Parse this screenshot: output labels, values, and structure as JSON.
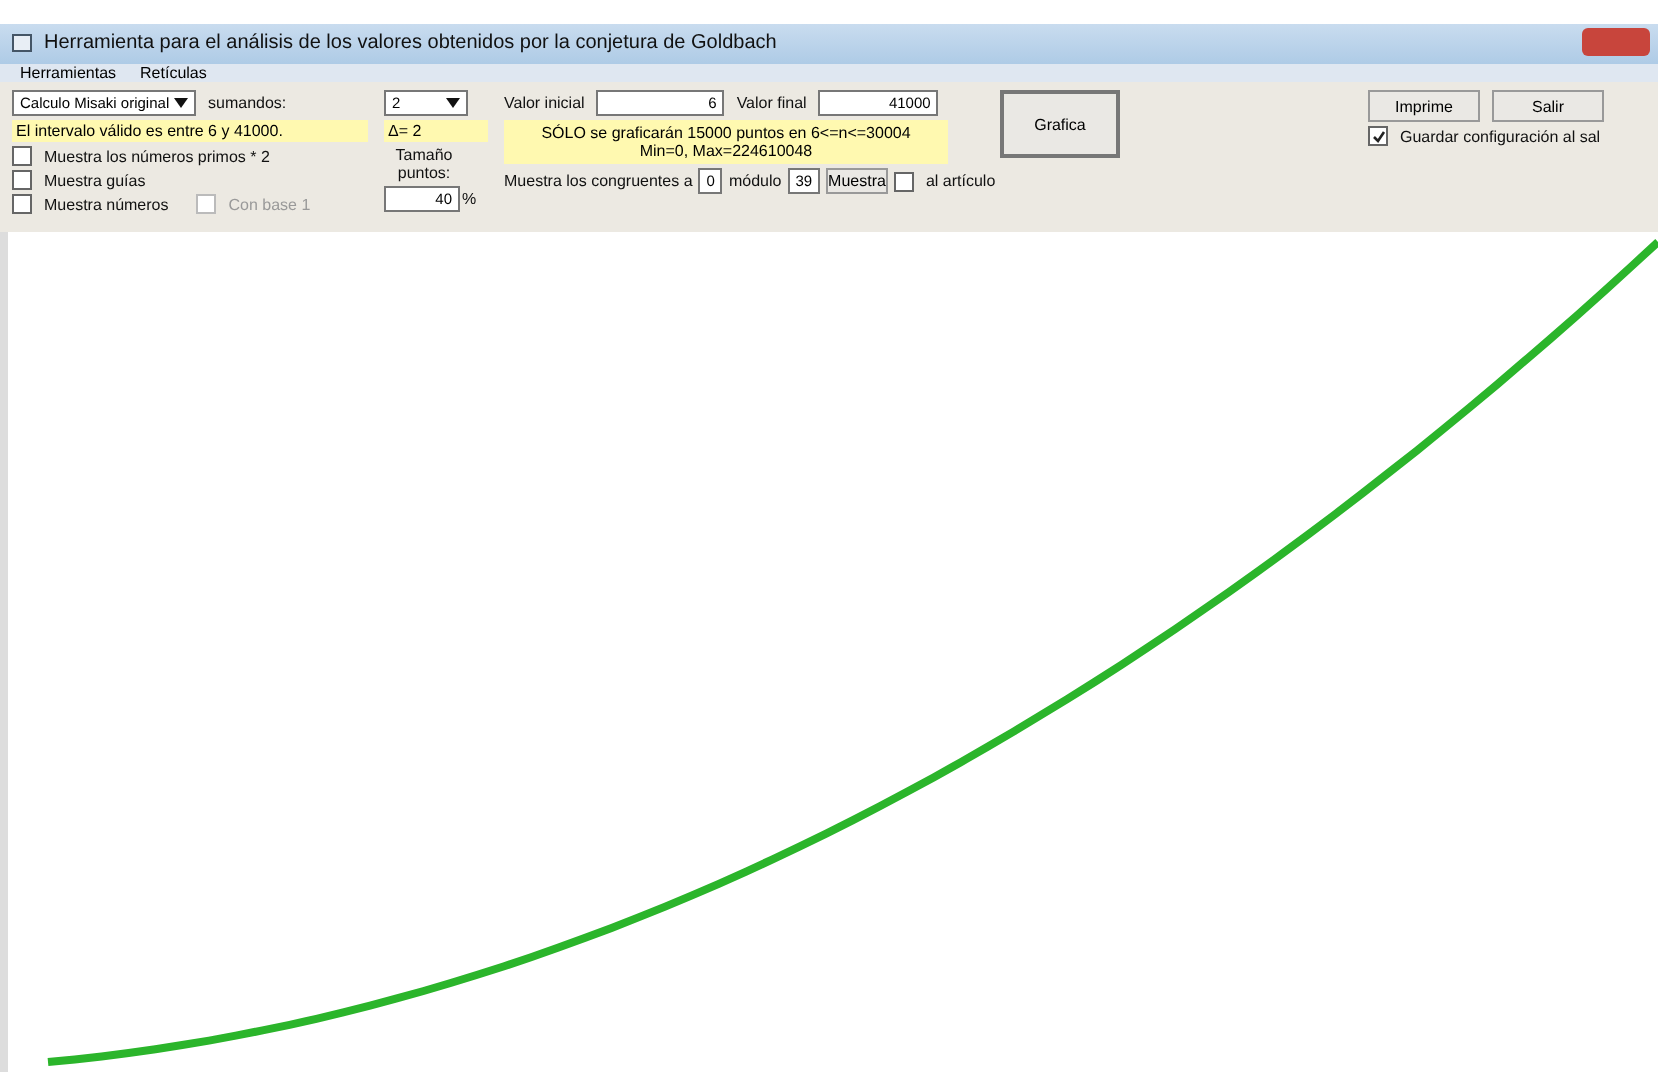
{
  "window": {
    "title": "Herramienta para el análisis de los valores obtenidos por la conjetura de Goldbach"
  },
  "menu": [
    "Herramientas",
    "Retículas"
  ],
  "method": {
    "value": "Calculo Misaki original"
  },
  "sumandos": {
    "label": "sumandos:",
    "value": "2"
  },
  "interval_note": "El intervalo válido es entre  6 y  41000.",
  "delta": "Δ= 2",
  "checkboxes": [
    {
      "label": "Muestra los números primos * 2",
      "checked": false,
      "disabled": false
    },
    {
      "label": "Muestra guías",
      "checked": false,
      "disabled": false
    },
    {
      "label": "Muestra números",
      "checked": false,
      "disabled": false
    },
    {
      "label": "Con base 1",
      "checked": false,
      "disabled": true
    }
  ],
  "point_size": {
    "label": "Tamaño puntos:",
    "value": "40",
    "unit": "%"
  },
  "start": {
    "label": "Valor inicial",
    "value": "6"
  },
  "end": {
    "label": "Valor final",
    "value": "41000"
  },
  "info": [
    "SÓLO se graficarán  15000 puntos en 6<=n<=30004",
    "Min=0, Max=224610048"
  ],
  "congruent": {
    "label": "Muestra los congruentes a",
    "value": "0",
    "modulo_label": "módulo",
    "modulo": "39",
    "button": "Muestra",
    "article": {
      "label": "al artículo",
      "checked": false
    }
  },
  "graph_button": "Grafica",
  "print_button": "Imprime",
  "exit_button": "Salir",
  "save_config": {
    "label": "Guardar configuración al sal",
    "checked": true
  }
}
